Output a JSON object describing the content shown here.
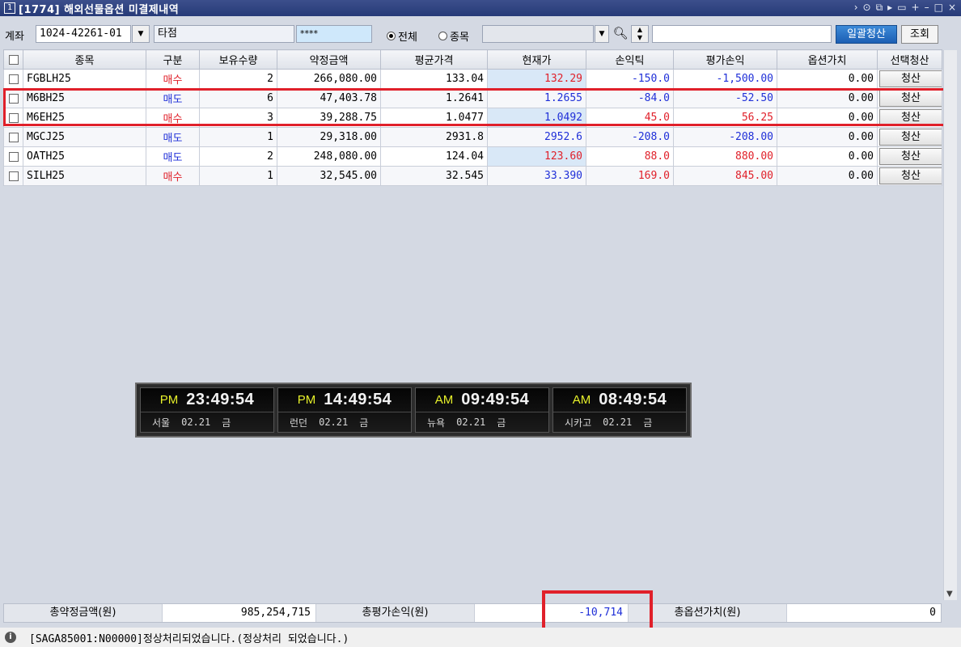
{
  "window": {
    "number": "1",
    "title": "[1774] 해외선물옵션 미결제내역",
    "controls": [
      "›",
      "⊙",
      "⧉",
      "▸",
      "▭",
      "+",
      "–",
      "□",
      "×"
    ]
  },
  "toolbar": {
    "account_label": "계좌",
    "account_value": "1024-42261-01",
    "account_name": "타점",
    "password_value": "****",
    "radio_all": "전체",
    "radio_item": "종목",
    "code_value": "",
    "bulk_close_button": "일괄청산",
    "query_button": "조회"
  },
  "table": {
    "headers": [
      "종목",
      "구분",
      "보유수량",
      "약정금액",
      "평균가격",
      "현재가",
      "손익틱",
      "평가손익",
      "옵션가치",
      "선택청산"
    ],
    "close_label": "청산",
    "rows": [
      {
        "code": "FGBLH25",
        "side": "매수",
        "qty": "2",
        "contract": "266,080.00",
        "avg": "133.04",
        "cur": "132.29",
        "tick": "-150.0",
        "pnl": "-1,500.00",
        "opt": "0.00",
        "side_color": "red",
        "cur_color": "red",
        "tick_color": "blue",
        "pnl_color": "blue"
      },
      {
        "code": "M6BH25",
        "side": "매도",
        "qty": "6",
        "contract": "47,403.78",
        "avg": "1.2641",
        "cur": "1.2655",
        "tick": "-84.0",
        "pnl": "-52.50",
        "opt": "0.00",
        "side_color": "blue",
        "cur_color": "blue",
        "tick_color": "blue",
        "pnl_color": "blue"
      },
      {
        "code": "M6EH25",
        "side": "매수",
        "qty": "3",
        "contract": "39,288.75",
        "avg": "1.0477",
        "cur": "1.0492",
        "tick": "45.0",
        "pnl": "56.25",
        "opt": "0.00",
        "side_color": "red",
        "cur_color": "blue",
        "tick_color": "red",
        "pnl_color": "red"
      },
      {
        "code": "MGCJ25",
        "side": "매도",
        "qty": "1",
        "contract": "29,318.00",
        "avg": "2931.8",
        "cur": "2952.6",
        "tick": "-208.0",
        "pnl": "-208.00",
        "opt": "0.00",
        "side_color": "blue",
        "cur_color": "blue",
        "tick_color": "blue",
        "pnl_color": "blue"
      },
      {
        "code": "OATH25",
        "side": "매도",
        "qty": "2",
        "contract": "248,080.00",
        "avg": "124.04",
        "cur": "123.60",
        "tick": "88.0",
        "pnl": "880.00",
        "opt": "0.00",
        "side_color": "blue",
        "cur_color": "red",
        "tick_color": "red",
        "pnl_color": "red"
      },
      {
        "code": "SILH25",
        "side": "매수",
        "qty": "1",
        "contract": "32,545.00",
        "avg": "32.545",
        "cur": "33.390",
        "tick": "169.0",
        "pnl": "845.00",
        "opt": "0.00",
        "side_color": "red",
        "cur_color": "blue",
        "tick_color": "red",
        "pnl_color": "red"
      }
    ]
  },
  "clocks": [
    {
      "ampm": "PM",
      "time": "23:49:54",
      "city": "서울",
      "date": "02.21",
      "day": "금"
    },
    {
      "ampm": "PM",
      "time": "14:49:54",
      "city": "런던",
      "date": "02.21",
      "day": "금"
    },
    {
      "ampm": "AM",
      "time": "09:49:54",
      "city": "뉴욕",
      "date": "02.21",
      "day": "금"
    },
    {
      "ampm": "AM",
      "time": "08:49:54",
      "city": "시카고",
      "date": "02.21",
      "day": "금"
    }
  ],
  "summary": {
    "total_contract_label": "총약정금액(원)",
    "total_contract_value": "985,254,715",
    "total_pnl_label": "총평가손익(원)",
    "total_pnl_value": "-10,714",
    "total_option_label": "총옵션가치(원)",
    "total_option_value": "0"
  },
  "status": {
    "message": "[SAGA85001:N00000]정상처리되었습니다.(정상처리 되었습니다.)"
  },
  "colors": {
    "red": "#e0202a",
    "blue": "#1f2fd8",
    "highlight": "#e0202a",
    "title_bar": "#263a78"
  }
}
